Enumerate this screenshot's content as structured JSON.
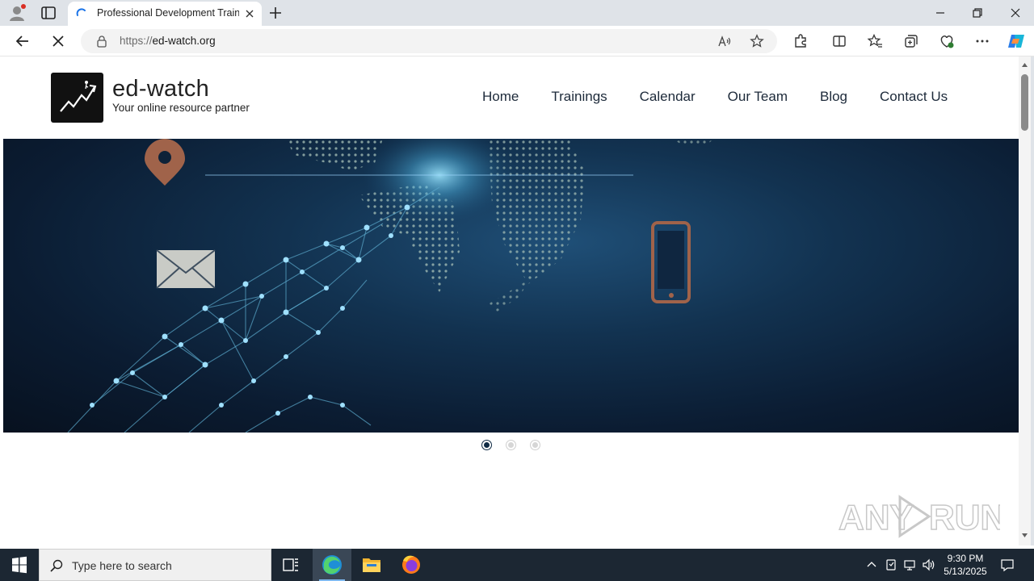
{
  "browser": {
    "tab_title": "Professional Development Trainin",
    "url_scheme": "https://",
    "url_host": "ed-watch.org"
  },
  "site": {
    "logo_name": "ed-watch",
    "logo_tagline": "Your online resource partner",
    "nav": [
      "Home",
      "Trainings",
      "Calendar",
      "Our Team",
      "Blog",
      "Contact Us"
    ]
  },
  "slider": {
    "slide_count": 3,
    "active_index": 0
  },
  "taskbar": {
    "search_placeholder": "Type here to search",
    "time": "9:30 PM",
    "date": "5/13/2025"
  },
  "watermark": "ANY RUN",
  "colors": {
    "accent": "#0f2a44",
    "taskbar": "#1c2733",
    "hero_dark": "#0b1c32",
    "icon_brown": "#a0634a"
  }
}
